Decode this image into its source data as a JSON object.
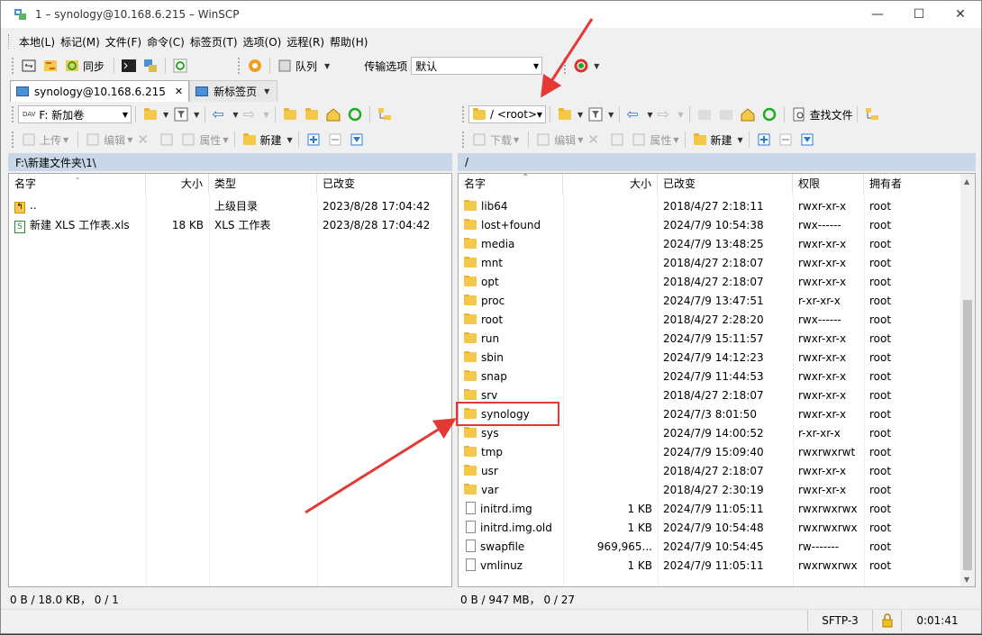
{
  "window": {
    "title": "1 – synology@10.168.6.215 – WinSCP"
  },
  "menu": [
    "本地(L)",
    "标记(M)",
    "文件(F)",
    "命令(C)",
    "标签页(T)",
    "选项(O)",
    "远程(R)",
    "帮助(H)"
  ],
  "toolbar": {
    "sync_label": "同步",
    "queue_label": "队列",
    "transfer_label": "传输选项",
    "transfer_value": "默认"
  },
  "tabs": [
    {
      "label": "synology@10.168.6.215",
      "close": "✕"
    },
    {
      "label": "新标签页"
    }
  ],
  "local": {
    "drive": "F: 新加卷",
    "upload_label": "上传",
    "edit_label": "编辑",
    "props_label": "属性",
    "new_label": "新建",
    "path": "F:\\新建文件夹\\1\\",
    "columns": [
      "名字",
      "大小",
      "类型",
      "已改变"
    ],
    "rows": [
      {
        "name": "..",
        "size": "",
        "type": "上级目录",
        "modified": "2023/8/28  17:04:42",
        "kind": "up"
      },
      {
        "name": "新建 XLS 工作表.xls",
        "size": "18 KB",
        "type": "XLS 工作表",
        "modified": "2023/8/28  17:04:42",
        "kind": "xls"
      }
    ],
    "status": "0 B / 18.0 KB， 0 / 1"
  },
  "remote": {
    "dir": "/ <root>",
    "find_label": "查找文件",
    "download_label": "下载",
    "edit_label": "编辑",
    "props_label": "属性",
    "new_label": "新建",
    "path": "/",
    "columns": [
      "名字",
      "大小",
      "已改变",
      "权限",
      "拥有者"
    ],
    "rows": [
      {
        "name": "lib64",
        "size": "",
        "modified": "2018/4/27 2:18:11",
        "perm": "rwxr-xr-x",
        "owner": "root",
        "kind": "dir"
      },
      {
        "name": "lost+found",
        "size": "",
        "modified": "2024/7/9 10:54:38",
        "perm": "rwx------",
        "owner": "root",
        "kind": "dir"
      },
      {
        "name": "media",
        "size": "",
        "modified": "2024/7/9 13:48:25",
        "perm": "rwxr-xr-x",
        "owner": "root",
        "kind": "dir"
      },
      {
        "name": "mnt",
        "size": "",
        "modified": "2018/4/27 2:18:07",
        "perm": "rwxr-xr-x",
        "owner": "root",
        "kind": "dir"
      },
      {
        "name": "opt",
        "size": "",
        "modified": "2018/4/27 2:18:07",
        "perm": "rwxr-xr-x",
        "owner": "root",
        "kind": "dir"
      },
      {
        "name": "proc",
        "size": "",
        "modified": "2024/7/9 13:47:51",
        "perm": "r-xr-xr-x",
        "owner": "root",
        "kind": "dir"
      },
      {
        "name": "root",
        "size": "",
        "modified": "2018/4/27 2:28:20",
        "perm": "rwx------",
        "owner": "root",
        "kind": "dir"
      },
      {
        "name": "run",
        "size": "",
        "modified": "2024/7/9 15:11:57",
        "perm": "rwxr-xr-x",
        "owner": "root",
        "kind": "dir"
      },
      {
        "name": "sbin",
        "size": "",
        "modified": "2024/7/9 14:12:23",
        "perm": "rwxr-xr-x",
        "owner": "root",
        "kind": "dir"
      },
      {
        "name": "snap",
        "size": "",
        "modified": "2024/7/9 11:44:53",
        "perm": "rwxr-xr-x",
        "owner": "root",
        "kind": "dir"
      },
      {
        "name": "srv",
        "size": "",
        "modified": "2018/4/27 2:18:07",
        "perm": "rwxr-xr-x",
        "owner": "root",
        "kind": "dir"
      },
      {
        "name": "synology",
        "size": "",
        "modified": "2024/7/3 8:01:50",
        "perm": "rwxr-xr-x",
        "owner": "root",
        "kind": "dir"
      },
      {
        "name": "sys",
        "size": "",
        "modified": "2024/7/9 14:00:52",
        "perm": "r-xr-xr-x",
        "owner": "root",
        "kind": "dir"
      },
      {
        "name": "tmp",
        "size": "",
        "modified": "2024/7/9 15:09:40",
        "perm": "rwxrwxrwt",
        "owner": "root",
        "kind": "dir"
      },
      {
        "name": "usr",
        "size": "",
        "modified": "2018/4/27 2:18:07",
        "perm": "rwxr-xr-x",
        "owner": "root",
        "kind": "dir"
      },
      {
        "name": "var",
        "size": "",
        "modified": "2018/4/27 2:30:19",
        "perm": "rwxr-xr-x",
        "owner": "root",
        "kind": "dir"
      },
      {
        "name": "initrd.img",
        "size": "1 KB",
        "modified": "2024/7/9 11:05:11",
        "perm": "rwxrwxrwx",
        "owner": "root",
        "kind": "link"
      },
      {
        "name": "initrd.img.old",
        "size": "1 KB",
        "modified": "2024/7/9 10:54:48",
        "perm": "rwxrwxrwx",
        "owner": "root",
        "kind": "link"
      },
      {
        "name": "swapfile",
        "size": "969,965...",
        "modified": "2024/7/9 10:54:45",
        "perm": "rw-------",
        "owner": "root",
        "kind": "file"
      },
      {
        "name": "vmlinuz",
        "size": "1 KB",
        "modified": "2024/7/9 11:05:11",
        "perm": "rwxrwxrwx",
        "owner": "root",
        "kind": "link"
      }
    ],
    "status": "0 B / 947 MB， 0 / 27"
  },
  "statusbar": {
    "protocol": "SFTP-3",
    "elapsed": "0:01:41"
  },
  "colors": {
    "annotation": "#e53935",
    "pathbar": "#c8d8e8",
    "folder": "#f5c84a"
  }
}
